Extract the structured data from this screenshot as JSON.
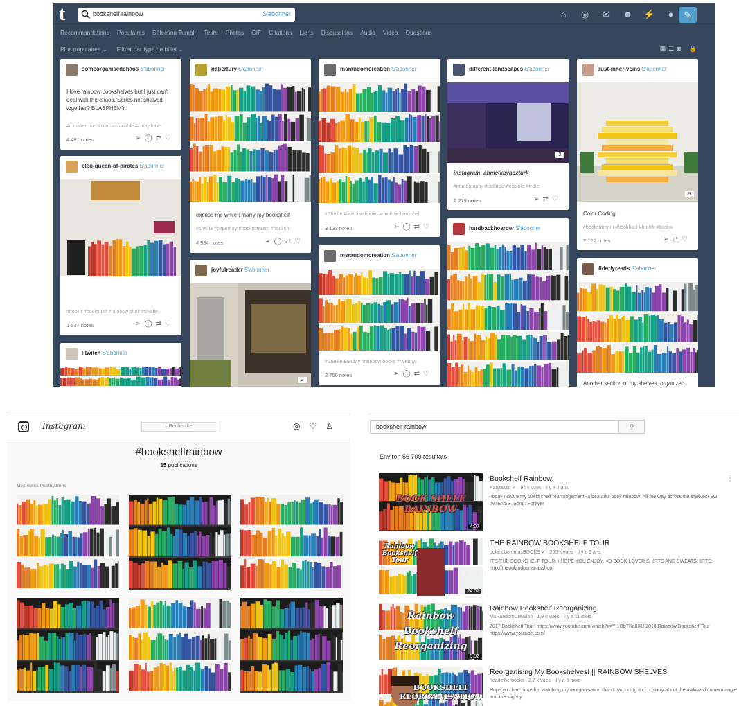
{
  "tumblr": {
    "logo": "t",
    "search_value": "bookshelf rainbow",
    "search_follow": "S'abonner",
    "nav": [
      "Recommandations",
      "Populaires",
      "Sélection Tumblr",
      "Texte",
      "Photos",
      "GIF",
      "Citations",
      "Liens",
      "Discussions",
      "Audio",
      "Vidéo",
      "Questions"
    ],
    "filters": [
      "Plus populaires ⌄",
      "Filtrer par type de billet ⌄"
    ],
    "follow_label": "S'abonner",
    "cards": [
      {
        "user": "someorganisedchaos",
        "text": "I love rainbow bookshelves but I just can't deal with the chaos. Series not shelved together? BLASPHEMY.",
        "tags": "#it makes me so uncomfortable   #i may have",
        "notes": "4 481 notes"
      },
      {
        "user": "cleo-queen-of-pirates",
        "tags": "#bookir   #bookshelf   #rainbow shelf   #shelfie",
        "notes": "1 537 notes"
      },
      {
        "user": "litwitch"
      },
      {
        "user": "paperfury",
        "text": "excuse me while i marry my bookshelf",
        "tags": "#shelfie   #paperfury   #bookstagram   #booksh",
        "notes": "4 984 notes"
      },
      {
        "user": "joyfulreader",
        "badge": "2"
      },
      {
        "user": "msrandomcreation",
        "tags": "#Shelfie   #rainbow books   #rainbow bookshel",
        "notes": "3 123 notes"
      },
      {
        "user": "msrandomcreation",
        "tags": "#Shelfie Sunday   #rainbow books   #rainbow",
        "notes": "2 750 notes"
      },
      {
        "user": "different-landscapes",
        "caption": "instagram: ahmetkayaozturk",
        "tags": "#photography   #radarplz   #explore   #indie",
        "notes": "2 279 notes",
        "badge": "2"
      },
      {
        "user": "hardbackhoarder"
      },
      {
        "user": "rust-inher-veins",
        "text": "Color Coding",
        "tags": "#bookstagram   #bookhaul   #booklr   #bookw",
        "notes": "2 122 notes",
        "badge": "9"
      },
      {
        "user": "fiderlyreads",
        "text": "Another section of my shelves, organized"
      }
    ]
  },
  "instagram": {
    "wordmark": "Instagram",
    "search_placeholder": "⌕ Rechercher",
    "hashtag": "#bookshelfrainbow",
    "count_number": "35",
    "count_label": "publications",
    "section": "Meilleures Publications"
  },
  "youtube": {
    "search_value": "bookshelf rainbow",
    "results_count": "Environ 56 700 résultats",
    "videos": [
      {
        "title": "Bookshelf Rainbow!",
        "meta": "Katytastic ✔ · 94 k vues · il y a 4 ans",
        "desc": "Today I share my latest shelf rearrangement--a beautiful book rainbow! All the way across the shelves! SO INTENSE. Song: Forever",
        "duration": "4:07",
        "thumb_text": "BOOK SHELF RAINBOW"
      },
      {
        "title": "THE RAINBOW BOOKSHELF TOUR",
        "meta": "polandbananasBOOKS ✔ · 255 k vues · il y a 2 ans",
        "desc": "IT'S THE BOOKSHELF TOUR. I HOPE YOU ENJOY. <D BOOK LOVER SHIRTS AND SWEATSHIRTS: http://thepolandbananasshop.",
        "duration": "24:07",
        "thumb_text": "Rainbow Bookshelf Tour"
      },
      {
        "title": "Rainbow Bookshelf Reorganizing",
        "meta": "MsRandomCreation · 1,9 k vues · il y a 11 mois",
        "desc": "2017 Bookshelf Tour: https://www.youtube.com/watch?v=Y-1ObTKa8XU 2016 Rainbow Bookshelf Tour https://www.youtube.com/",
        "duration": "5:52",
        "thumb_text": "Rainbow Bookshelf Reorganizing"
      },
      {
        "title": "Reorganising My Bookshelves! || RAINBOW SHELVES",
        "meta": "headinherbooks · 2,7 k vues · il y a 6 mois",
        "desc": "Hope you had more fun watching my reorganisation than I had doing it r i p (sorry about the awkward camera angle and the slightly",
        "duration": "",
        "thumb_text": "BOOKSHELF REORGANISATION!"
      }
    ]
  },
  "colors": {
    "tumblr_bg": "#36465d",
    "tumblr_link": "#529ecc",
    "instagram_text": "#262626"
  }
}
